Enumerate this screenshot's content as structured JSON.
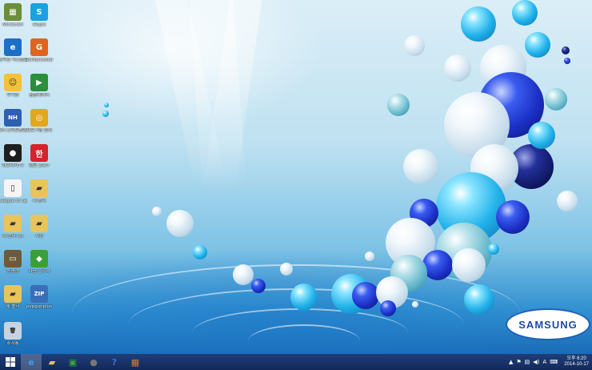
{
  "desktop": {
    "icons": [
      {
        "label": "Minecraft",
        "color": "#6b8e3a",
        "glyph": "▦"
      },
      {
        "label": "Skype",
        "color": "#1ba1e2",
        "glyph": "S"
      },
      {
        "label": "인터넷 익스플로러",
        "color": "#1b6fc7",
        "glyph": "e"
      },
      {
        "label": "GomEncoder",
        "color": "#e0641b",
        "glyph": "G"
      },
      {
        "label": "쿠키런",
        "color": "#f4c236",
        "glyph": "☺"
      },
      {
        "label": "곰플레이어",
        "color": "#2d8f3c",
        "glyph": "▶"
      },
      {
        "label": "NH 스마트뱅킹",
        "color": "#2e5fb0",
        "glyph": "NH"
      },
      {
        "label": "프로그램 설치",
        "color": "#e2a71a",
        "glyph": "◎"
      },
      {
        "label": "아프리카TV",
        "color": "#1e1e1e",
        "glyph": "●"
      },
      {
        "label": "한글 2007",
        "color": "#d6232c",
        "glyph": "한"
      },
      {
        "label": "League of Legends",
        "color": "#f5f5f5",
        "glyph": "▯"
      },
      {
        "label": "새 폴더",
        "color": "#e8c45a",
        "glyph": "▰"
      },
      {
        "label": "새 폴더 (2)",
        "color": "#e8c45a",
        "glyph": "▰"
      },
      {
        "label": "사진",
        "color": "#e8c45a",
        "glyph": "▰"
      },
      {
        "label": "동영상",
        "color": "#6e5a3a",
        "glyph": "▭"
      },
      {
        "label": "다음 클리너",
        "color": "#3b9e3a",
        "glyph": "◆"
      },
      {
        "label": "새 폴더",
        "color": "#e8c45a",
        "glyph": "▰"
      },
      {
        "label": "pvpgunplus",
        "color": "#3a6fb8",
        "glyph": "ZIP"
      },
      {
        "label": "휴지통",
        "color": "#c7d3df",
        "glyph": "🗑"
      }
    ],
    "brand_logo": "SAMSUNG"
  },
  "taskbar": {
    "start_icon": "windows-logo-icon",
    "pinned": [
      {
        "name": "internet-explorer-icon",
        "glyph": "e",
        "color": "#3c9ce8",
        "active": true
      },
      {
        "name": "file-explorer-icon",
        "glyph": "▰",
        "color": "#e8c45a",
        "active": false
      },
      {
        "name": "store-icon",
        "glyph": "▣",
        "color": "#35a63a",
        "active": false
      },
      {
        "name": "media-icon",
        "glyph": "●",
        "color": "#777777",
        "active": false
      },
      {
        "name": "help-icon",
        "glyph": "?",
        "color": "#3c6fd8",
        "active": false
      },
      {
        "name": "app-icon",
        "glyph": "▦",
        "color": "#e07b2a",
        "active": false
      }
    ],
    "tray": {
      "ime": "A",
      "time": "오후 6:20",
      "date": "2014-10-17"
    }
  }
}
